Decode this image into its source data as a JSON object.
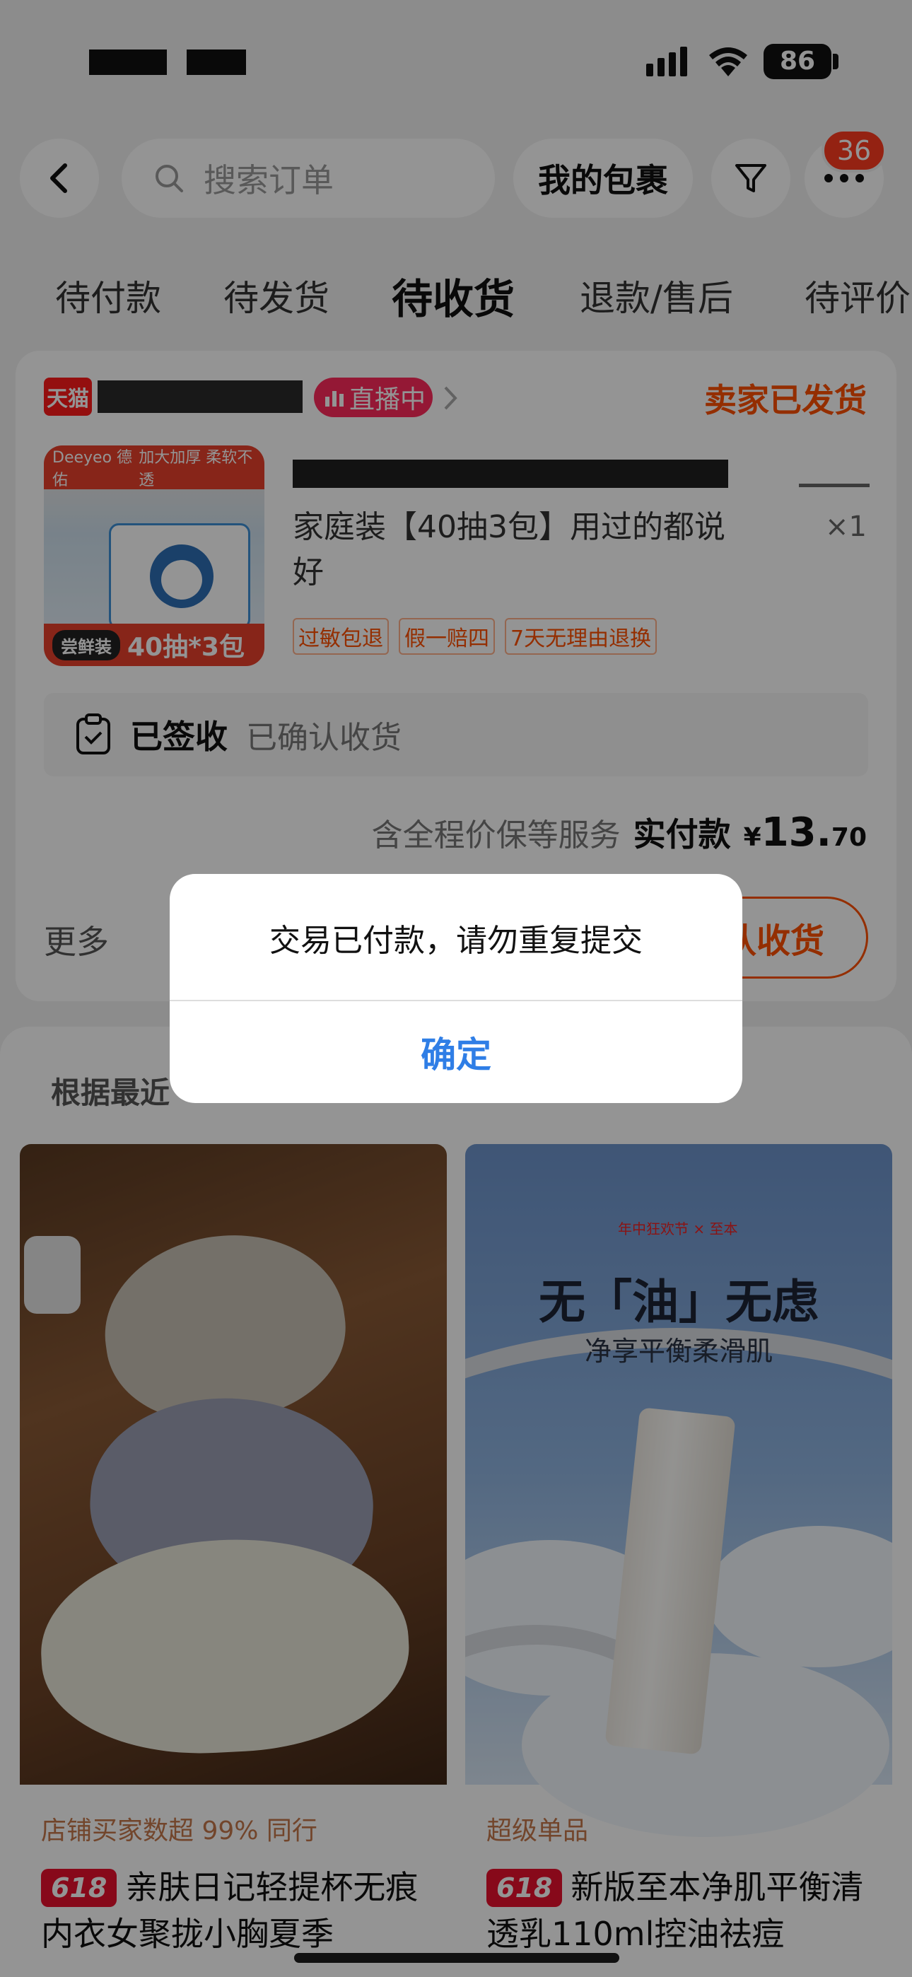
{
  "status_bar": {
    "battery": "86"
  },
  "header": {
    "search_placeholder": "搜索订单",
    "packages_button": "我的包裹",
    "more_badge": "36"
  },
  "tabs": [
    {
      "label": "待付款"
    },
    {
      "label": "待发货"
    },
    {
      "label": "待收货"
    },
    {
      "label": "退款/售后"
    },
    {
      "label": "待评价"
    }
  ],
  "order": {
    "shop_badge": "天猫",
    "live_tag": "直播中",
    "status": "卖家已发货",
    "product_image": {
      "banner_left": "Deeyeo 德佑",
      "banner_right": "加大加厚 柔软不透",
      "footer_tag": "尝鲜装",
      "footer_text": "40抽*3包"
    },
    "product_title": "家庭装【40抽3包】用过的都说好",
    "quantity": "×1",
    "tags": [
      "过敏包退",
      "假一赔四",
      "7天无理由退换"
    ],
    "signed_label": "已签收",
    "signed_note": "已确认收货",
    "service_note": "含全程价保等服务",
    "paid_label": "实付款",
    "currency": "¥",
    "price_int": "13.",
    "price_dec": "70",
    "more_label": "更多",
    "confirm_label": "认收货"
  },
  "recommend": {
    "title": "根据最近",
    "items": [
      {
        "hint": "店铺买家数超 99% 同行",
        "tag": "618",
        "title": "亲肤日记轻提杯无痕内衣女聚拢小胸夏季"
      },
      {
        "hint": "超级单品",
        "tag": "618",
        "title": "新版至本净肌平衡清透乳110ml控油祛痘",
        "ad_brand": "年中狂欢节 × 至本",
        "ad_title": "无「油」无虑",
        "ad_subtitle": "净享平衡柔滑肌"
      }
    ]
  },
  "dialog": {
    "message": "交易已付款，请勿重复提交",
    "ok_label": "确定"
  }
}
